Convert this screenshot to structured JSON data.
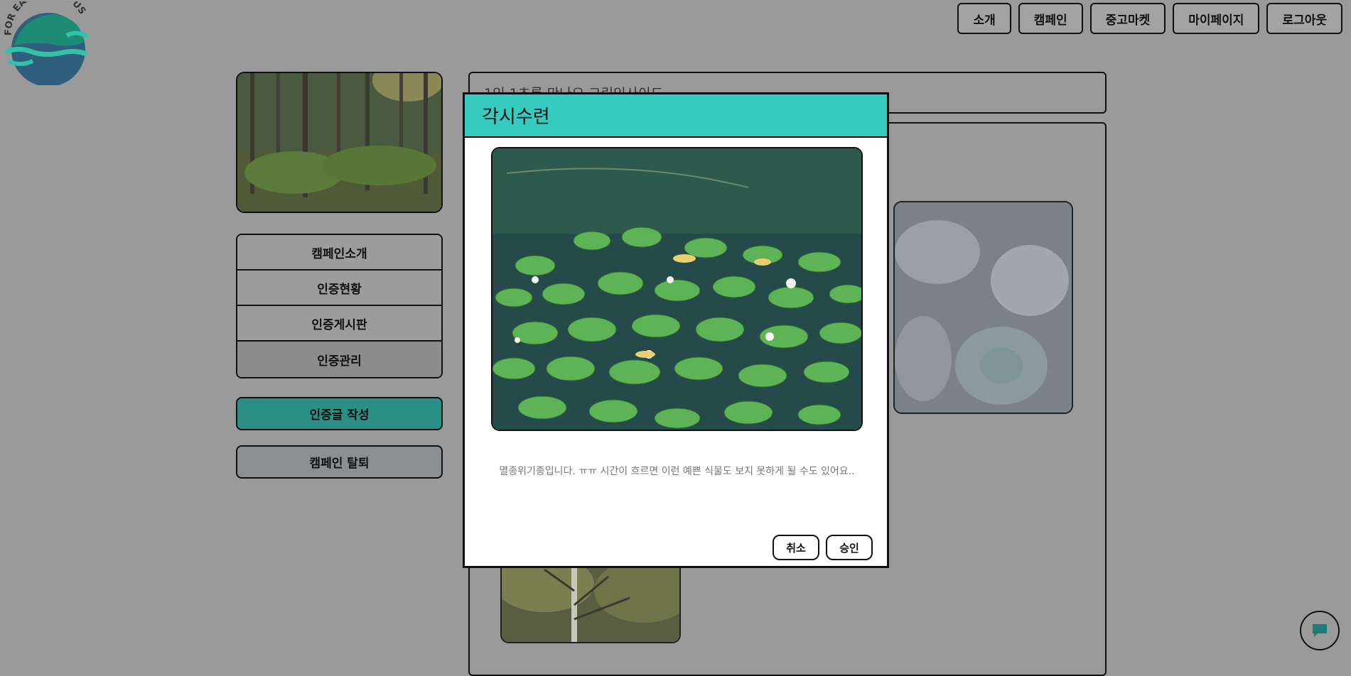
{
  "logo": {
    "text": "FOR EARTH FOR US"
  },
  "topnav": {
    "items": [
      {
        "label": "소개"
      },
      {
        "label": "캠페인"
      },
      {
        "label": "중고마켓"
      },
      {
        "label": "마이페이지"
      },
      {
        "label": "로그아웃"
      }
    ]
  },
  "sidebar": {
    "menu": [
      {
        "label": "캠페인소개"
      },
      {
        "label": "인증현황"
      },
      {
        "label": "인증게시판"
      },
      {
        "label": "인증관리"
      }
    ],
    "write_label": "인증글 작성",
    "leave_label": "캠페인 탈퇴"
  },
  "main": {
    "campaign_title": "1인 1초록 만나요 그린인사이드"
  },
  "modal": {
    "title": "각시수련",
    "description": "멸종위기종입니다. ㅠㅠ 시간이 흐르면 이런 예쁜 식물도 보지 못하게 될 수도 있어요..",
    "cancel_label": "취소",
    "approve_label": "승인"
  },
  "colors": {
    "modal_header": "#35cbc1",
    "write_button": "#2b8f86",
    "leave_button": "#8b8f92",
    "overlay_bg": "#9a9a9a"
  },
  "icons": {
    "chat": "chat-bubble-icon"
  }
}
